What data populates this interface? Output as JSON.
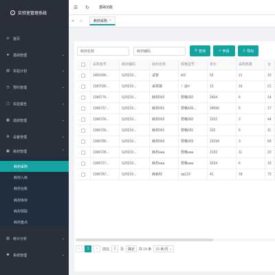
{
  "app": {
    "title": "实验室管理系统"
  },
  "sidebar": {
    "items": [
      {
        "icon": "home-icon",
        "glyph": "⊙",
        "label": "首页"
      },
      {
        "icon": "star-icon",
        "glyph": "★",
        "label": "基础管理"
      },
      {
        "icon": "plan-icon",
        "glyph": "▤",
        "label": "实验计划"
      },
      {
        "icon": "booking-icon",
        "glyph": "◷",
        "label": "预约管理"
      },
      {
        "icon": "report-icon",
        "glyph": "▢",
        "label": "实验报告"
      },
      {
        "icon": "grade-icon",
        "glyph": "▦",
        "label": "成绩管理"
      },
      {
        "icon": "device-icon",
        "glyph": "⚙",
        "label": "设备管理"
      },
      {
        "icon": "material-icon",
        "glyph": "▣",
        "label": "耗材管理"
      }
    ],
    "submenu": [
      "耗材采购",
      "耗材入库",
      "耗材台账",
      "耗材库存",
      "耗材领取",
      "耗材盘点"
    ],
    "bottom_items": [
      {
        "icon": "stats-icon",
        "glyph": "▥",
        "label": "统计分析"
      },
      {
        "icon": "system-icon",
        "glyph": "✱",
        "label": "系统管理"
      }
    ]
  },
  "topbar": {
    "breadcrumb": "基础功能"
  },
  "tags": {
    "active": "耗材采购"
  },
  "search": {
    "name_placeholder": "耗材名称",
    "code_placeholder": "耗材编码"
  },
  "buttons": {
    "query": "查询",
    "add": "申请",
    "export": "导出"
  },
  "table": {
    "headers": [
      "采购批号",
      "耗材编码",
      "耗材名称",
      "规格型号",
      "单价",
      "采购数量",
      "合"
    ],
    "rows": [
      [
        "1400396...",
        "S20210...",
        "试管",
        "AS",
        "52",
        "21",
        "10"
      ],
      [
        "1397030...",
        "S20210...",
        "采样袋",
        "！@#",
        "12",
        "16",
        "21"
      ],
      [
        "1396776...",
        "S20210...",
        "耗材002",
        "规格002",
        "2434",
        "6",
        "14"
      ],
      [
        "1396737...",
        "S20210...",
        "耗材001",
        "规格436...",
        "34556",
        "5",
        "17"
      ],
      [
        "1396726...",
        "S20210...",
        "耗材002",
        "规格002",
        "2222",
        "2",
        "44"
      ],
      [
        "1396726...",
        "S20210...",
        "耗材001",
        "规格001",
        "222",
        "5",
        "11"
      ],
      [
        "1396785...",
        "S20210...",
        "耗材003",
        "规格003",
        "23234",
        "3",
        "69"
      ],
      [
        "1396728...",
        "S20210...",
        "耗材aaa",
        "规格aaa",
        "2132",
        "11",
        "23"
      ],
      [
        "1396727...",
        "S20210...",
        "耗材aaa",
        "规格aaa",
        "3234",
        "6",
        "19"
      ],
      [
        "1396787...",
        "S20210...",
        "耗耗材",
        "qq123",
        "41",
        "18",
        "73"
      ]
    ]
  },
  "pagination": {
    "current_page": "1",
    "goto_label": "前往",
    "goto_value": "1",
    "page_suffix": "页",
    "confirm": "确定",
    "total": "共 10 条",
    "page_size": "10 条/页"
  },
  "colors": {
    "accent": "#13a3a0",
    "sidebar_bg": "#2b2f3a"
  }
}
